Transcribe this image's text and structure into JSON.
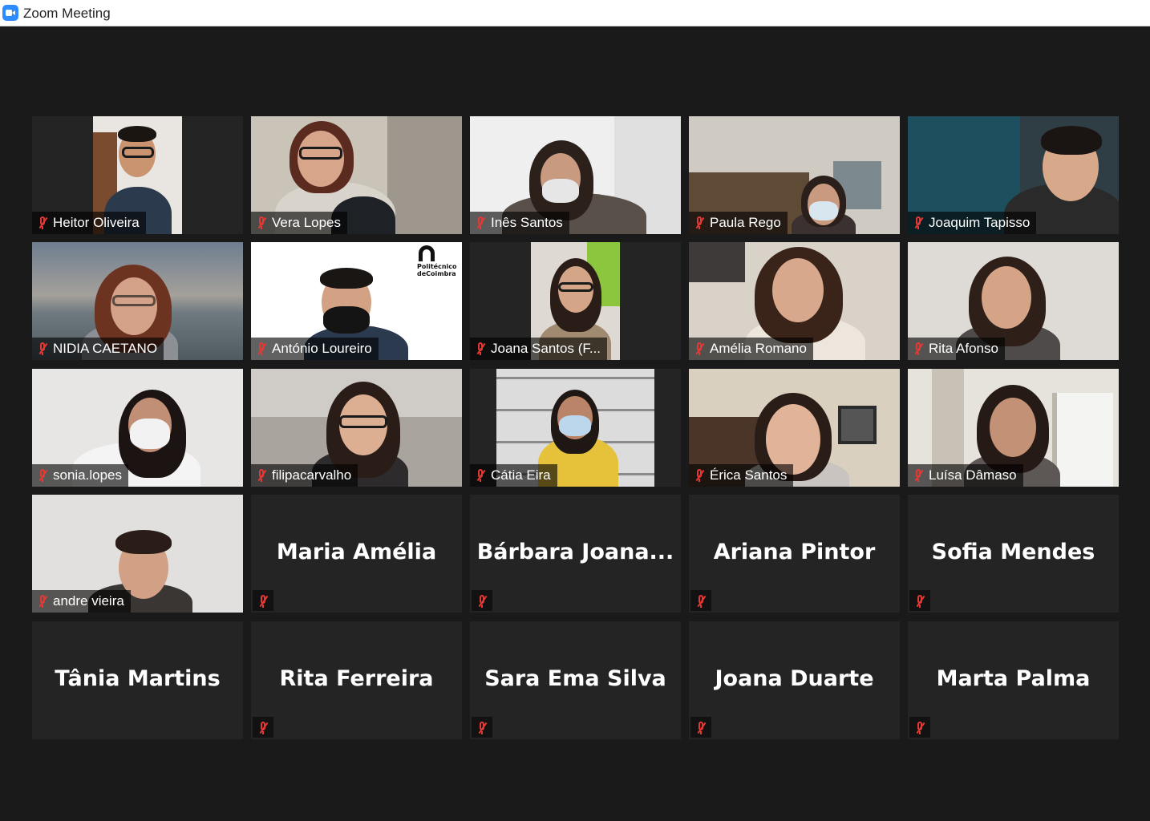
{
  "window": {
    "title": "Zoom Meeting",
    "app_icon": "zoom-camera-icon",
    "accent": "#2d8cff"
  },
  "video_tiles": [
    {
      "name": "Heitor Oliveira",
      "muted": true
    },
    {
      "name": "Vera Lopes",
      "muted": true
    },
    {
      "name": "Inês Santos",
      "muted": true
    },
    {
      "name": "Paula Rego",
      "muted": true
    },
    {
      "name": "Joaquim Tapisso",
      "muted": true
    },
    {
      "name": "NIDIA CAETANO",
      "muted": true
    },
    {
      "name": "António Loureiro",
      "muted": true
    },
    {
      "name": "Joana Santos (F...",
      "muted": true
    },
    {
      "name": "Amélia Romano",
      "muted": true
    },
    {
      "name": "Rita Afonso",
      "muted": true
    },
    {
      "name": "sonia.lopes",
      "muted": true
    },
    {
      "name": "filipacarvalho",
      "muted": true
    },
    {
      "name": "Cátia Eira",
      "muted": true
    },
    {
      "name": "Érica Santos",
      "muted": true
    },
    {
      "name": "Luísa Dâmaso",
      "muted": true
    },
    {
      "name": "andre vieira",
      "muted": true
    }
  ],
  "name_tiles": [
    {
      "name": "Maria Amélia",
      "muted": true
    },
    {
      "name": "Bárbara  Joana...",
      "muted": true
    },
    {
      "name": "Ariana Pintor",
      "muted": true
    },
    {
      "name": "Sofia Mendes",
      "muted": true
    },
    {
      "name": "Tânia Martins",
      "muted": false
    },
    {
      "name": "Rita Ferreira",
      "muted": true
    },
    {
      "name": "Sara Ema Silva",
      "muted": true
    },
    {
      "name": "Joana Duarte",
      "muted": true
    },
    {
      "name": "Marta Palma",
      "muted": true
    }
  ],
  "logo": {
    "line1": "Politécnico",
    "line2": "deCoimbra"
  },
  "colors": {
    "muted_icon": "#e53935",
    "tile_bg": "#242424",
    "stage_bg": "#1a1a1a"
  }
}
